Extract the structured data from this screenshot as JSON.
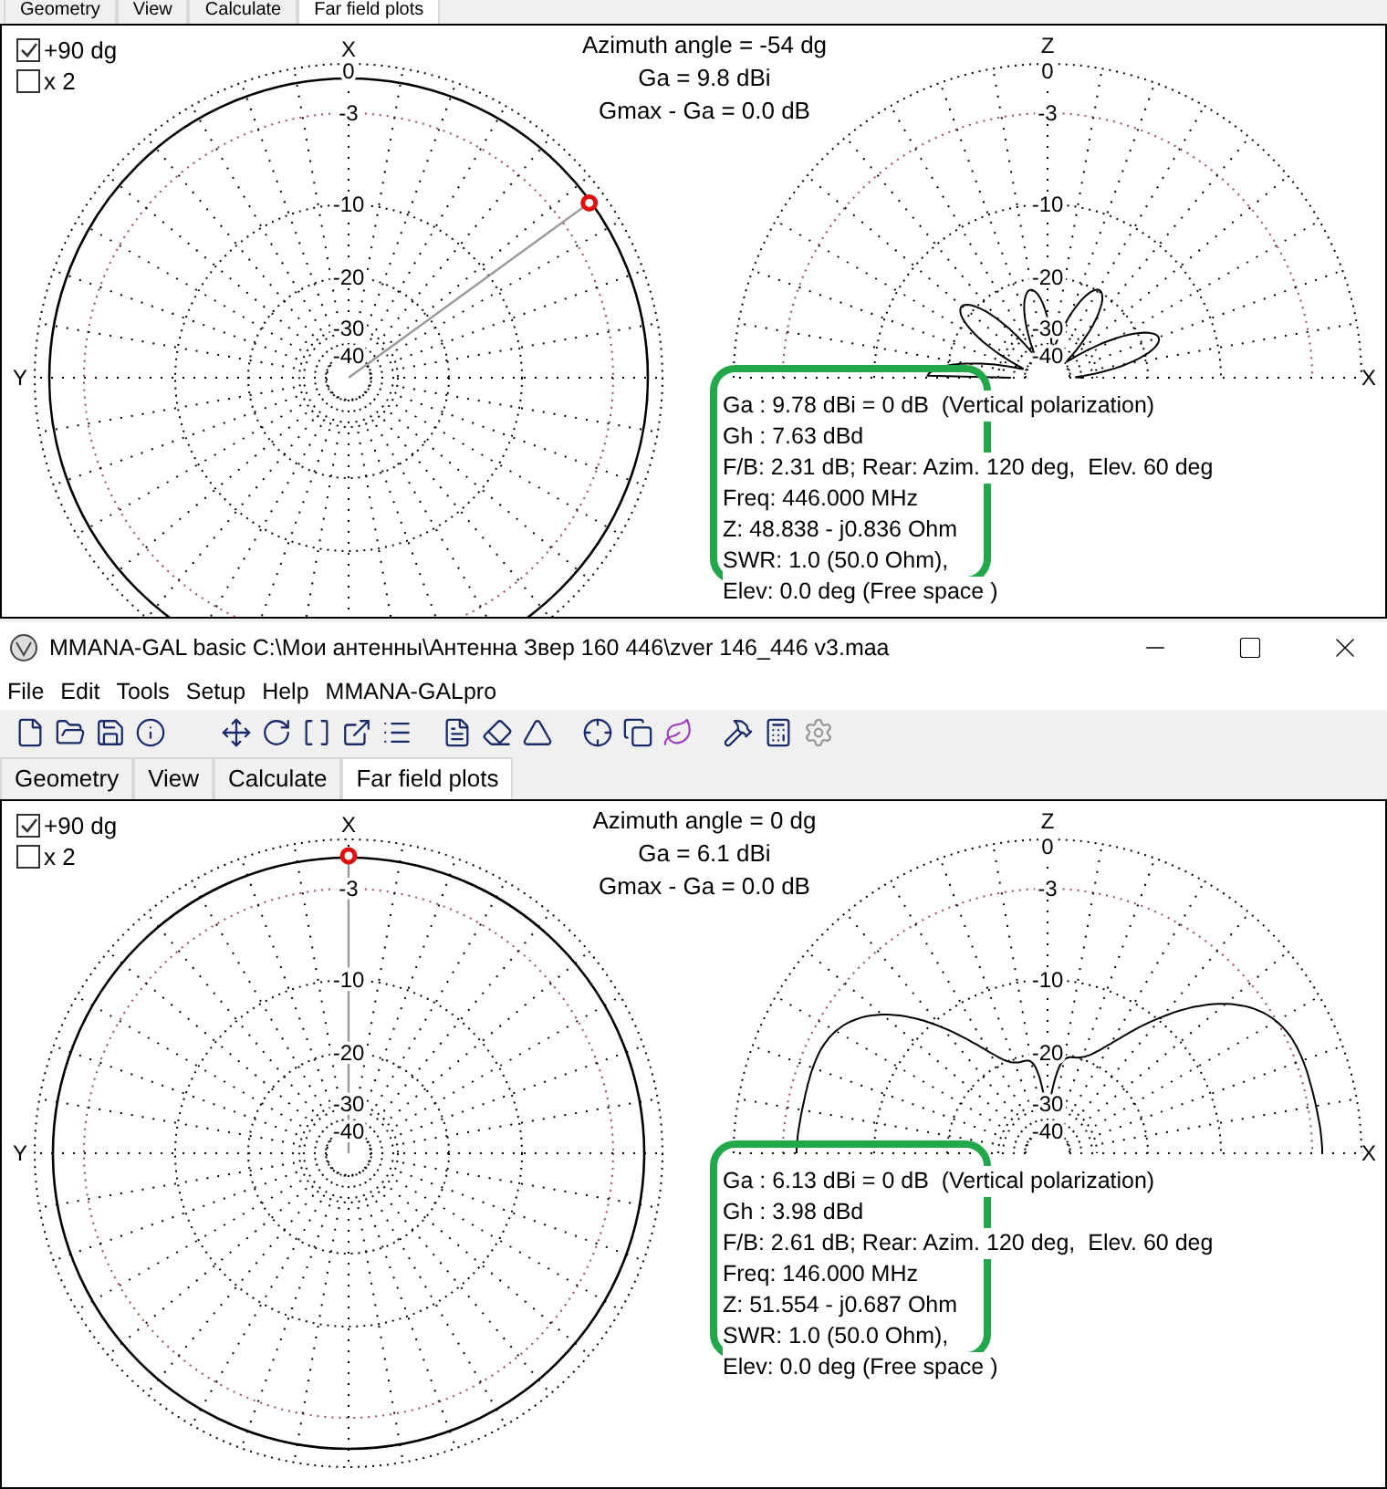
{
  "top_panel": {
    "tabs": [
      {
        "label": "Geometry",
        "selected": false
      },
      {
        "label": "View",
        "selected": false
      },
      {
        "label": "Calculate",
        "selected": false
      },
      {
        "label": "Far field plots",
        "selected": true
      }
    ],
    "plot": {
      "options": [
        {
          "label": "+90 dg",
          "checked": true
        },
        {
          "label": "x 2",
          "checked": false
        }
      ],
      "header": [
        "Azimuth angle = -54 dg",
        "Ga = 9.8 dBi",
        "Gmax - Ga = 0.0 dB"
      ],
      "azimuth_plot": {
        "x_label": "X",
        "y_label": "Y",
        "ring_labels": [
          "0",
          "-3",
          "-10",
          "-20",
          "-30",
          "-40"
        ]
      },
      "elevation_plot": {
        "z_label": "Z",
        "x_label": "X",
        "ring_labels": [
          "0",
          "-3",
          "-10",
          "-20",
          "-30",
          "-40"
        ]
      },
      "results": [
        "Ga : 9.78 dBi = 0 dB  (Vertical polarization)",
        "Gh : 7.63 dBd",
        "F/B: 2.31 dB; Rear: Azim. 120 deg,  Elev. 60 deg",
        "Freq: 446.000 MHz",
        "Z: 48.838 - j0.836 Ohm",
        "SWR: 1.0 (50.0 Ohm),"
      ],
      "footer": "Elev: 0.0 deg (Free space )"
    }
  },
  "window": {
    "title": "MMANA-GAL basic C:\\Мои антенны\\Антенна Звер 160 446\\zver  146_446 v3.maa",
    "menu": [
      "File",
      "Edit",
      "Tools",
      "Setup",
      "Help",
      "MMANA-GALpro"
    ],
    "tabs": [
      {
        "label": "Geometry",
        "selected": false
      },
      {
        "label": "View",
        "selected": false
      },
      {
        "label": "Calculate",
        "selected": false
      },
      {
        "label": "Far field plots",
        "selected": true
      }
    ],
    "plot": {
      "options": [
        {
          "label": "+90 dg",
          "checked": true
        },
        {
          "label": "x 2",
          "checked": false
        }
      ],
      "header": [
        "Azimuth angle = 0 dg",
        "Ga = 6.1 dBi",
        "Gmax - Ga = 0.0 dB"
      ],
      "azimuth_plot": {
        "x_label": "X",
        "y_label": "Y",
        "ring_labels": [
          "-3",
          "-10",
          "-20",
          "-30",
          "-40"
        ]
      },
      "elevation_plot": {
        "z_label": "Z",
        "x_label": "X",
        "ring_labels": [
          "0",
          "-3",
          "-10",
          "-20",
          "-30",
          "-40"
        ]
      },
      "results": [
        "Ga : 6.13 dBi = 0 dB  (Vertical polarization)",
        "Gh : 3.98 dBd",
        "F/B: 2.61 dB; Rear: Azim. 120 deg,  Elev. 60 deg",
        "Freq: 146.000 MHz",
        "Z: 51.554 - j0.687 Ohm",
        "SWR: 1.0 (50.0 Ohm),"
      ],
      "footer": "Elev: 0.0 deg (Free space )"
    }
  }
}
